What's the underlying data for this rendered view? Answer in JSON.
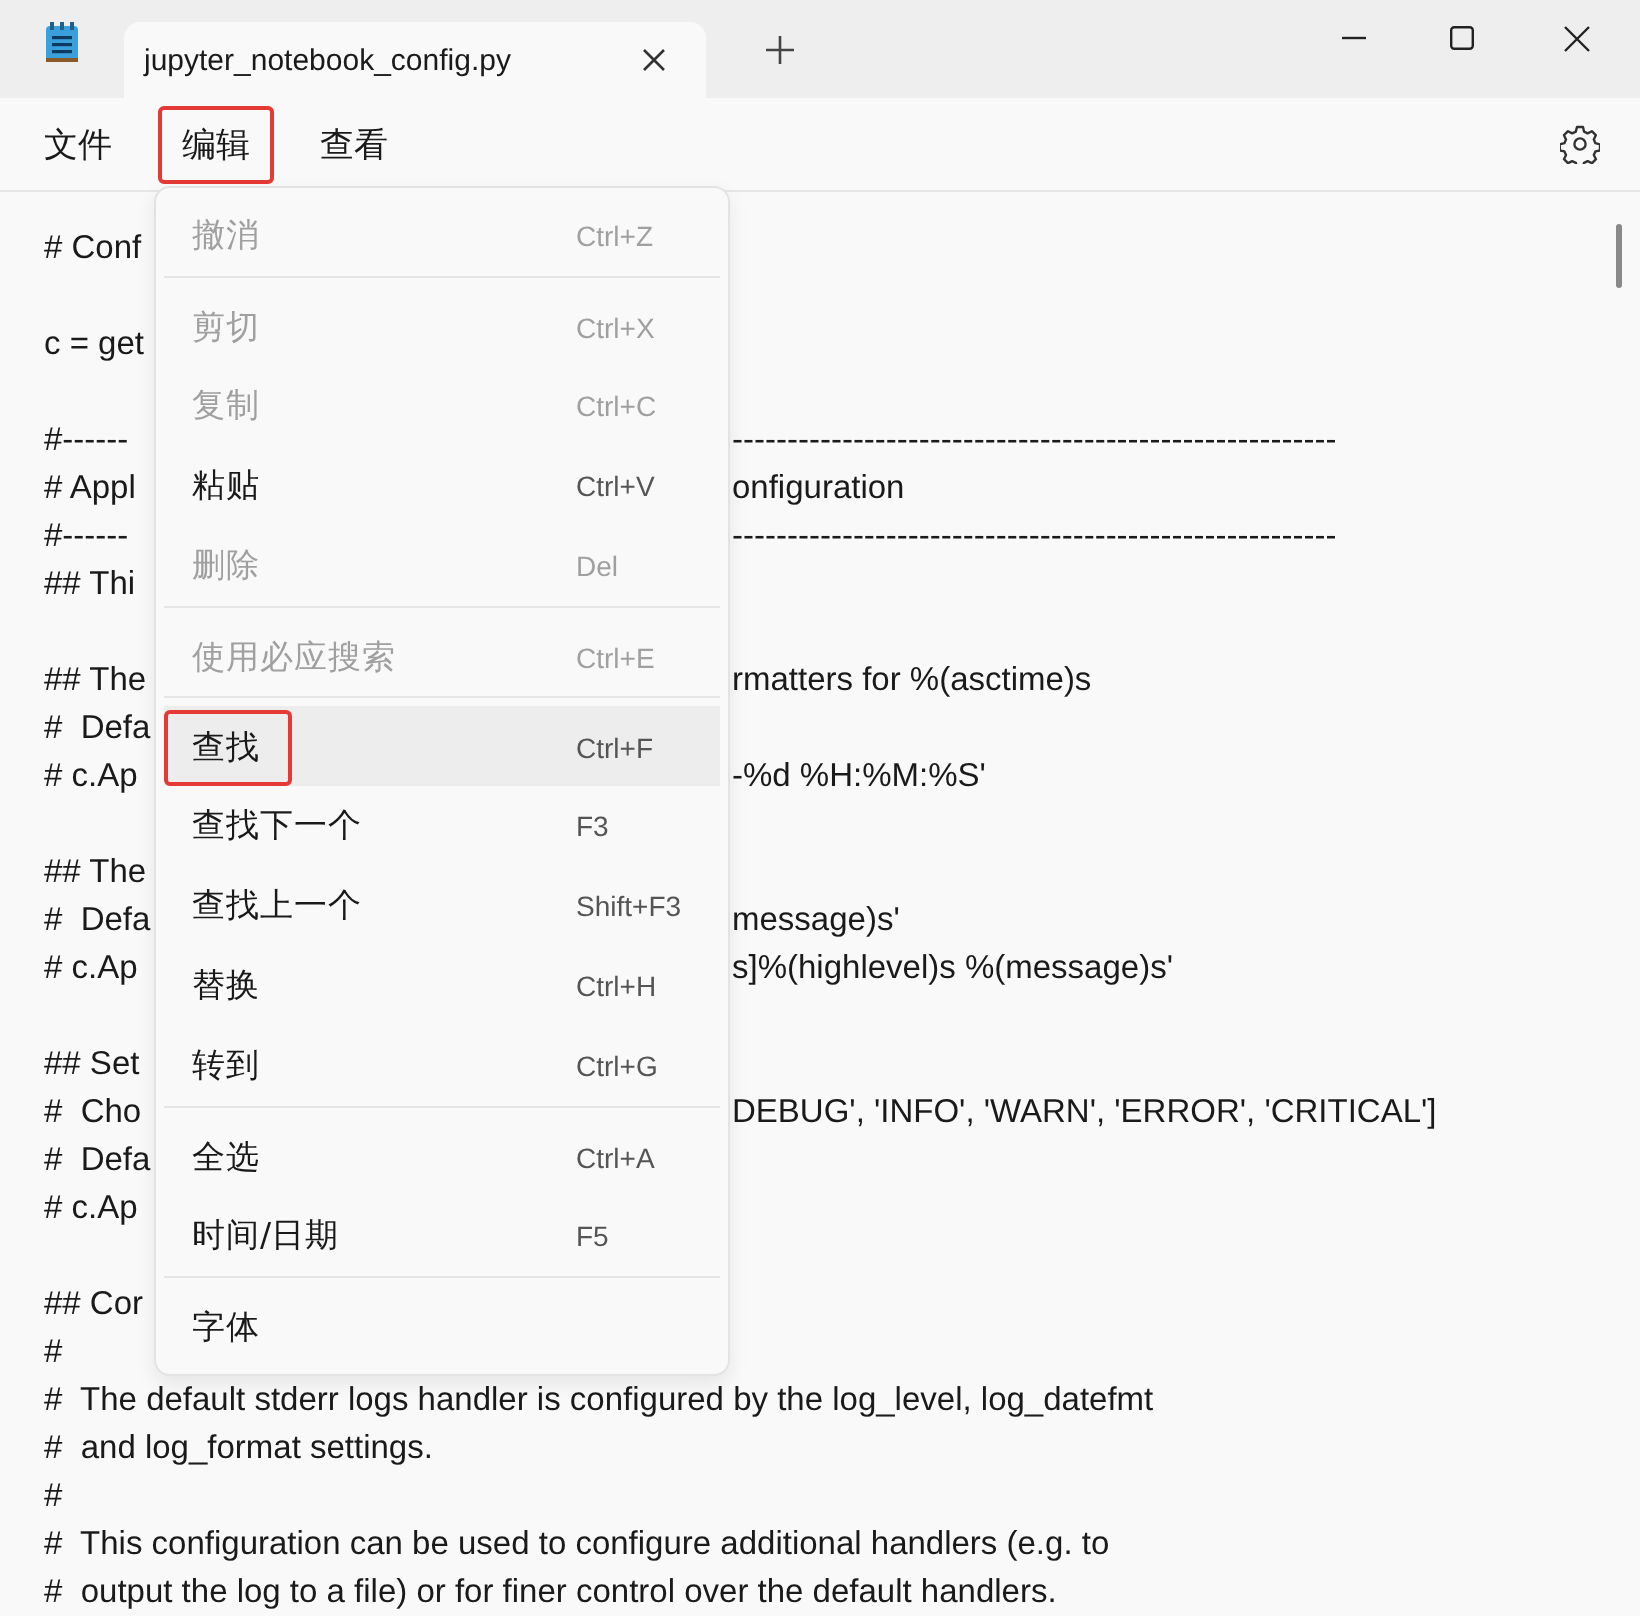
{
  "window": {
    "tab_title": "jupyter_notebook_config.py"
  },
  "menubar": [
    {
      "label": "文件",
      "marked": false
    },
    {
      "label": "编辑",
      "marked": true
    },
    {
      "label": "查看",
      "marked": false
    }
  ],
  "editor_lines": [
    {
      "kind": "text",
      "text": "# Conf"
    },
    {
      "kind": "blank"
    },
    {
      "kind": "text",
      "text": "c = get"
    },
    {
      "kind": "blank"
    },
    {
      "kind": "text",
      "text": "#------",
      "right": "-------------------------------------------------------"
    },
    {
      "kind": "text",
      "text": "# Appl",
      "right": "onfiguration"
    },
    {
      "kind": "text",
      "text": "#------",
      "right": "-------------------------------------------------------"
    },
    {
      "kind": "text",
      "text": "## Thi"
    },
    {
      "kind": "blank"
    },
    {
      "kind": "text",
      "text": "## The",
      "right": "rmatters for %(asctime)s"
    },
    {
      "kind": "text",
      "text": "#  Defa"
    },
    {
      "kind": "text",
      "text": "# c.Ap",
      "right": "-%d %H:%M:%S'"
    },
    {
      "kind": "blank"
    },
    {
      "kind": "text",
      "text": "## The"
    },
    {
      "kind": "text",
      "text": "#  Defa",
      "right": "message)s'"
    },
    {
      "kind": "text",
      "text": "# c.Ap",
      "right": "s]%(highlevel)s %(message)s'"
    },
    {
      "kind": "blank"
    },
    {
      "kind": "text",
      "text": "## Set"
    },
    {
      "kind": "text",
      "text": "#  Cho",
      "right": "DEBUG', 'INFO', 'WARN', 'ERROR', 'CRITICAL']"
    },
    {
      "kind": "text",
      "text": "#  Defa"
    },
    {
      "kind": "text",
      "text": "# c.Ap"
    },
    {
      "kind": "blank"
    },
    {
      "kind": "text",
      "text": "## Cor"
    },
    {
      "kind": "text",
      "text": "#"
    },
    {
      "kind": "text",
      "text": "#  The default stderr logs handler is configured by the log_level, log_datefmt"
    },
    {
      "kind": "text",
      "text": "#  and log_format settings."
    },
    {
      "kind": "text",
      "text": "#"
    },
    {
      "kind": "text",
      "text": "#  This configuration can be used to configure additional handlers (e.g. to"
    },
    {
      "kind": "text",
      "text": "#  output the log to a file) or for finer control over the default handlers."
    }
  ],
  "edit_menu": [
    {
      "label": "撤消",
      "shortcut": "Ctrl+Z",
      "disabled": true,
      "selected": false,
      "marked": false,
      "separator_before": false
    },
    {
      "label": "剪切",
      "shortcut": "Ctrl+X",
      "disabled": true,
      "selected": false,
      "marked": false,
      "separator_before": true
    },
    {
      "label": "复制",
      "shortcut": "Ctrl+C",
      "disabled": true,
      "selected": false,
      "marked": false,
      "separator_before": false
    },
    {
      "label": "粘贴",
      "shortcut": "Ctrl+V",
      "disabled": false,
      "selected": false,
      "marked": false,
      "separator_before": false
    },
    {
      "label": "删除",
      "shortcut": "Del",
      "disabled": true,
      "selected": false,
      "marked": false,
      "separator_before": false
    },
    {
      "label": "使用必应搜索",
      "shortcut": "Ctrl+E",
      "disabled": true,
      "selected": false,
      "marked": false,
      "separator_before": true
    },
    {
      "label": "查找",
      "shortcut": "Ctrl+F",
      "disabled": false,
      "selected": true,
      "marked": true,
      "separator_before": true
    },
    {
      "label": "查找下一个",
      "shortcut": "F3",
      "disabled": false,
      "selected": false,
      "marked": false,
      "separator_before": false
    },
    {
      "label": "查找上一个",
      "shortcut": "Shift+F3",
      "disabled": false,
      "selected": false,
      "marked": false,
      "separator_before": false
    },
    {
      "label": "替换",
      "shortcut": "Ctrl+H",
      "disabled": false,
      "selected": false,
      "marked": false,
      "separator_before": false
    },
    {
      "label": "转到",
      "shortcut": "Ctrl+G",
      "disabled": false,
      "selected": false,
      "marked": false,
      "separator_before": false
    },
    {
      "label": "全选",
      "shortcut": "Ctrl+A",
      "disabled": false,
      "selected": false,
      "marked": false,
      "separator_before": true
    },
    {
      "label": "时间/日期",
      "shortcut": "F5",
      "disabled": false,
      "selected": false,
      "marked": false,
      "separator_before": false
    },
    {
      "label": "字体",
      "disabled": false,
      "selected": false,
      "marked": false,
      "separator_before": true
    }
  ]
}
